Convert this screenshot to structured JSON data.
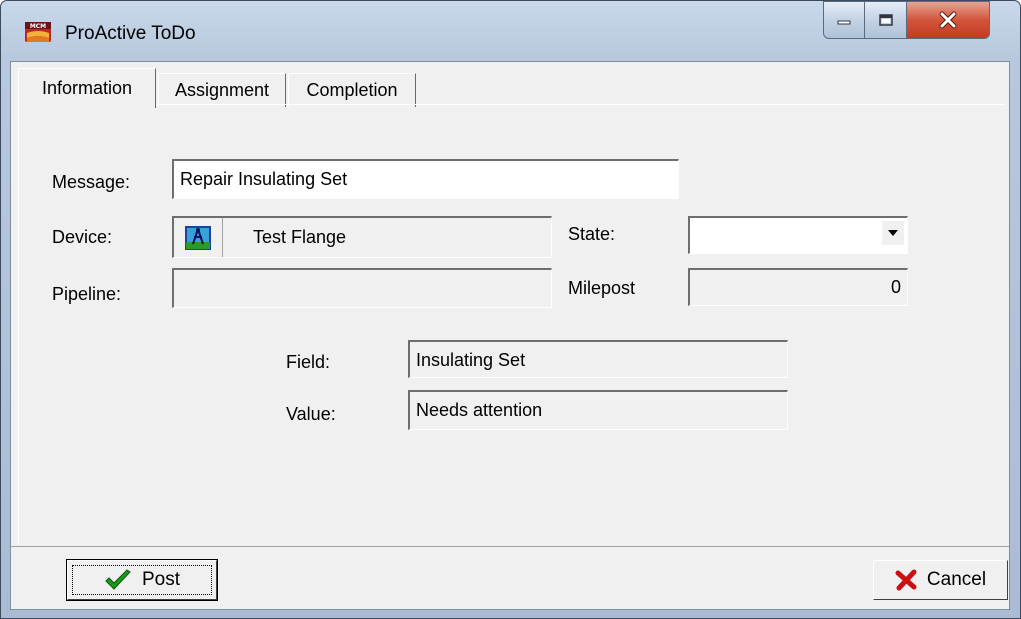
{
  "window": {
    "title": "ProActive ToDo",
    "app_icon": "mcm-logo-icon",
    "caption_buttons": [
      "minimize-icon",
      "maximize-icon",
      "close-icon"
    ]
  },
  "tabs": [
    {
      "label": "Information",
      "active": true
    },
    {
      "label": "Assignment",
      "active": false
    },
    {
      "label": "Completion",
      "active": false
    }
  ],
  "form": {
    "message_label": "Message:",
    "message_value": "Repair Insulating Set",
    "device_label": "Device:",
    "device_icon": "device-flange-icon",
    "device_value": "Test Flange",
    "state_label": "State:",
    "state_value": "",
    "pipeline_label": "Pipeline:",
    "pipeline_value": "",
    "milepost_label": "Milepost",
    "milepost_value": "0",
    "field_label": "Field:",
    "field_value": "Insulating Set",
    "value_label": "Value:",
    "value_value": "Needs attention"
  },
  "buttons": {
    "post_label": "Post",
    "post_icon": "checkmark-icon",
    "cancel_label": "Cancel",
    "cancel_icon": "x-icon"
  },
  "colors": {
    "checkmark": "#1a9a1a",
    "cancel_x": "#cc1010",
    "close_button": "#c9442b"
  }
}
